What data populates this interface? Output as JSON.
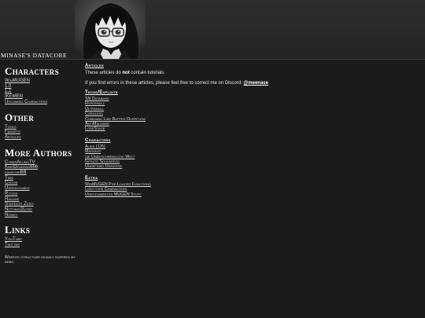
{
  "site": {
    "title": "Minase's Datacore"
  },
  "sidebar": {
    "characters": {
      "heading": "Characters",
      "items": [
        "WinMUGEN",
        "1.0",
        "1.1",
        "IKEMEN",
        "Upcoming Characters"
      ]
    },
    "other": {
      "heading": "Other",
      "items": [
        "Tools",
        "Fanarts",
        "Articles"
      ]
    },
    "more_authors": {
      "heading": "More Authors",
      "items": [
        "CyberAkumaTV",
        "KingDeadend666",
        "kamiyoriBB",
        "Tims",
        "Choon",
        "Unreachable",
        "Ryozis",
        "Hagane",
        "Stardust Zero",
        "Nothing2Lose",
        "Noisky"
      ]
    },
    "links": {
      "heading": "Links",
      "items": [
        "YouTube",
        "Twitter"
      ]
    },
    "note": "Website structure heavily inspired by nrbk."
  },
  "main": {
    "articles": {
      "heading": "Articles",
      "intro_a": "These articles do ",
      "intro_b": "not",
      "intro_c": " contain tutorials.",
      "errors_a": "If you find errors in these articles, please feel free to correct me on Discord: ",
      "errors_b": "@meenase"
    },
    "techs": {
      "heading": "Techs/Exploits",
      "items": [
        "SN Database",
        "Hypernull",
        "Ultranull",
        "Cordless",
        "Command Line Buffer Overflow",
        "AntiMalware",
        "LoseStage"
      ]
    },
    "characters": {
      "heading": "Characters",
      "items": [
        "Alien (JJ5)",
        "Matarus",
        "die Unbeschreibliche Welt",
        "Infinite Soulbreed",
        "Undefined Universe"
      ]
    },
    "extra": {
      "heading": "Extra",
      "items": [
        "WinMUGEN Pre-Loaded Functions",
        "Lost-type Characters",
        "Undocumented MUGEN Stuff"
      ]
    }
  }
}
